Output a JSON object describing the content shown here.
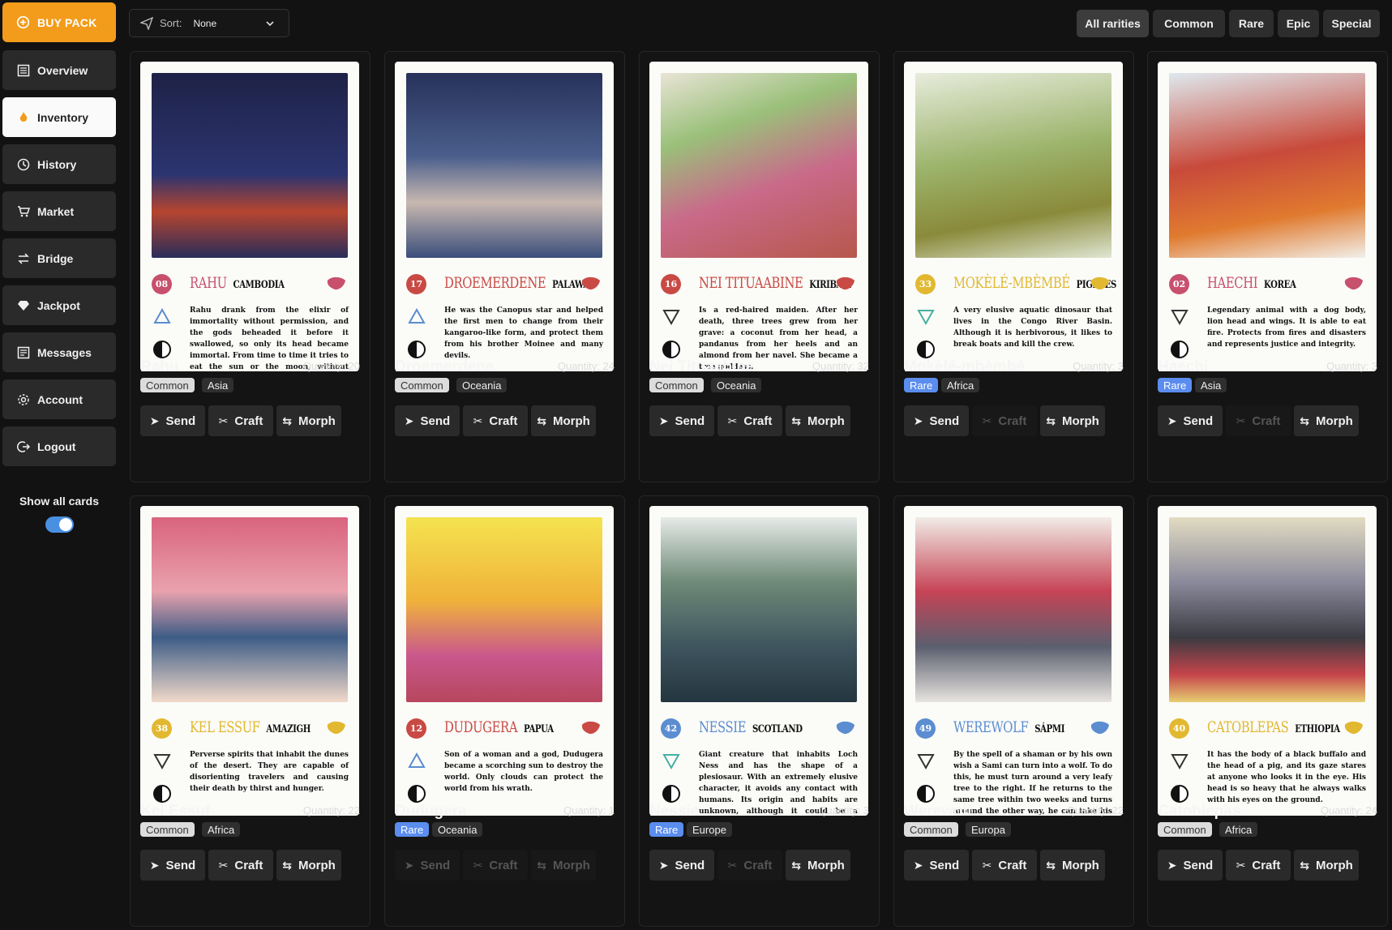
{
  "sidebar": {
    "buy_pack": "BUY PACK",
    "items": [
      {
        "label": "Overview",
        "icon": "overview-icon",
        "active": false
      },
      {
        "label": "Inventory",
        "icon": "fire-icon",
        "active": true
      },
      {
        "label": "History",
        "icon": "clock-icon",
        "active": false
      },
      {
        "label": "Market",
        "icon": "cart-icon",
        "active": false
      },
      {
        "label": "Bridge",
        "icon": "arrows-icon",
        "active": false
      },
      {
        "label": "Jackpot",
        "icon": "diamond-icon",
        "active": false
      },
      {
        "label": "Messages",
        "icon": "messages-icon",
        "active": false
      },
      {
        "label": "Account",
        "icon": "gear-icon",
        "active": false
      },
      {
        "label": "Logout",
        "icon": "logout-icon",
        "active": false
      }
    ],
    "show_all_label": "Show all cards",
    "show_all_on": true
  },
  "toolbar": {
    "sort_label": "Sort:",
    "sort_value": "None",
    "rarities": [
      "All rarities",
      "Common",
      "Rare",
      "Epic",
      "Special"
    ],
    "active_rarity": "All rarities"
  },
  "actions": {
    "send": "Send",
    "craft": "Craft",
    "morph": "Morph"
  },
  "quantity_label": "Quantity:",
  "cards": [
    {
      "name": "Rahu",
      "qty": "20",
      "rarity": "Common",
      "region": "Asia",
      "num": "08",
      "art_name": "RAHU",
      "art_country": "CAMBODIA",
      "desc": "Rahu drank from the elixir of immortality without permission, and the gods beheaded it before it swallowed, so only its head became immortal. From time to time it tries to eat the sun or the moon, without being able to hold them back, causing eclipses.",
      "craft": true,
      "morph": true,
      "send": true
    },
    {
      "name": "Droemerdene",
      "qty": "24",
      "rarity": "Common",
      "region": "Oceania",
      "num": "17",
      "art_name": "DROEMERDENE",
      "art_country": "PALAWA",
      "desc": "He was the Canopus star and helped the first men to change from their kangaroo-like form, and protect them from his brother Moinee and many devils.",
      "craft": true,
      "morph": true,
      "send": true
    },
    {
      "name": "Nei Tituaabine",
      "qty": "32",
      "rarity": "Common",
      "region": "Oceania",
      "num": "16",
      "art_name": "NEI TITUAABINE",
      "art_country": "KIRIBATI",
      "desc": "Is a red-haired maiden. After her death, three trees grew from her grave: a coconut from her head, a pandanus from her heels and an almond from her navel. She became a tree goddess.",
      "craft": true,
      "morph": true,
      "send": true
    },
    {
      "name": "Mokèlé-mbèmbé",
      "qty": "3",
      "rarity": "Rare",
      "region": "Africa",
      "num": "33",
      "art_name": "MOKÈLÉ-MBÈMBÉ",
      "art_country": "PIGMIES",
      "desc": "A very elusive aquatic dinosaur that lives in the Congo River Basin. Although it is herbivorous, it likes to break boats and kill the crew.",
      "craft": false,
      "morph": true,
      "send": true
    },
    {
      "name": "Haechi",
      "qty": "3",
      "rarity": "Rare",
      "region": "Asia",
      "num": "02",
      "art_name": "HAECHI",
      "art_country": "KOREA",
      "desc": "Legendary animal with a dog body, lion head and wings. It is able to eat fire. Protects from fires and disasters and represents justice and integrity.",
      "craft": false,
      "morph": true,
      "send": true
    },
    {
      "name": "Kel Essuf",
      "qty": "22",
      "rarity": "Common",
      "region": "Africa",
      "num": "38",
      "art_name": "KEL ESSUF",
      "art_country": "AMAZIGH",
      "desc": "Perverse spirits that inhabit the dunes of the desert. They are capable of disorienting travelers and causing their death by thirst and hunger.",
      "craft": true,
      "morph": true,
      "send": true
    },
    {
      "name": "Dudugera",
      "qty": "1",
      "rarity": "Rare",
      "region": "Oceania",
      "num": "12",
      "art_name": "DUDUGERA",
      "art_country": "PAPUA",
      "desc": "Son of a woman and a god, Dudugera became a scorching sun to destroy the world. Only clouds can protect the world from his wrath.",
      "craft": false,
      "morph": false,
      "send": false
    },
    {
      "name": "Nessie",
      "qty": "3",
      "rarity": "Rare",
      "region": "Europe",
      "num": "42",
      "art_name": "NESSIE",
      "art_country": "SCOTLAND",
      "desc": "Giant creature that inhabits Loch Ness and has the shape of a plesiosaur. With an extremely elusive character, it avoids any contact with humans. Its origin and habits are unknown, although it could be a dinosaur that survived the extinction of its conspecifics frozen in the lake.",
      "craft": false,
      "morph": true,
      "send": true
    },
    {
      "name": "Werewolf",
      "qty": "22",
      "rarity": "Common",
      "region": "Europa",
      "num": "49",
      "art_name": "WEREWOLF",
      "art_country": "SÁPMI",
      "desc": "By the spell of a shaman or by his own wish a Sami can turn into a wolf. To do this, he must turn around a very leafy tree to the right. If he returns to the same tree within two weeks and turns around the other way, he can take his human form again.",
      "craft": true,
      "morph": true,
      "send": true
    },
    {
      "name": "Catoblepas",
      "qty": "24",
      "rarity": "Common",
      "region": "Africa",
      "num": "40",
      "art_name": "CATOBLEPAS",
      "art_country": "ETHIOPIA",
      "desc": "It has the body of a black buffalo and the head of a pig, and its gaze stares at anyone who looks it in the eye. His head is so heavy that he always walks with his eyes on the ground.",
      "craft": true,
      "morph": true,
      "send": true
    }
  ],
  "colors": {
    "accent": "#f39c1b",
    "rare": "#5b8def",
    "common": "#dcdcdc"
  }
}
